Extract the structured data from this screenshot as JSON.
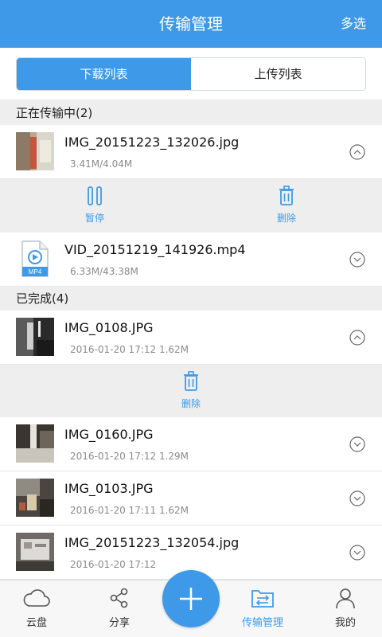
{
  "header": {
    "title": "传输管理",
    "multi_select": "多选"
  },
  "tabs": {
    "download": "下载列表",
    "upload": "上传列表"
  },
  "sections": {
    "transferring": "正在传输中(2)",
    "completed": "已完成(4)"
  },
  "transferring": [
    {
      "name": "IMG_20151223_132026.jpg",
      "meta": "3.41M/4.04M",
      "state": "paused"
    },
    {
      "name": "VID_20151219_141926.mp4",
      "meta": "6.33M/43.38M",
      "badge": "MP4"
    }
  ],
  "transfer_actions": {
    "pause": "暂停",
    "delete": "删除"
  },
  "completed": [
    {
      "name": "IMG_0108.JPG",
      "meta": "2016-01-20 17:12  1.62M"
    },
    {
      "name": "IMG_0160.JPG",
      "meta": "2016-01-20 17:12  1.29M"
    },
    {
      "name": "IMG_0103.JPG",
      "meta": "2016-01-20 17:11  1.62M"
    },
    {
      "name": "IMG_20151223_132054.jpg",
      "meta": "2016-01-20 17:12"
    }
  ],
  "completed_actions": {
    "delete": "删除"
  },
  "nav": {
    "cloud": "云盘",
    "share": "分享",
    "transfer": "传输管理",
    "mine": "我的"
  },
  "colors": {
    "accent": "#3e9ae8",
    "text": "#222222",
    "meta": "#8a8a8a"
  }
}
